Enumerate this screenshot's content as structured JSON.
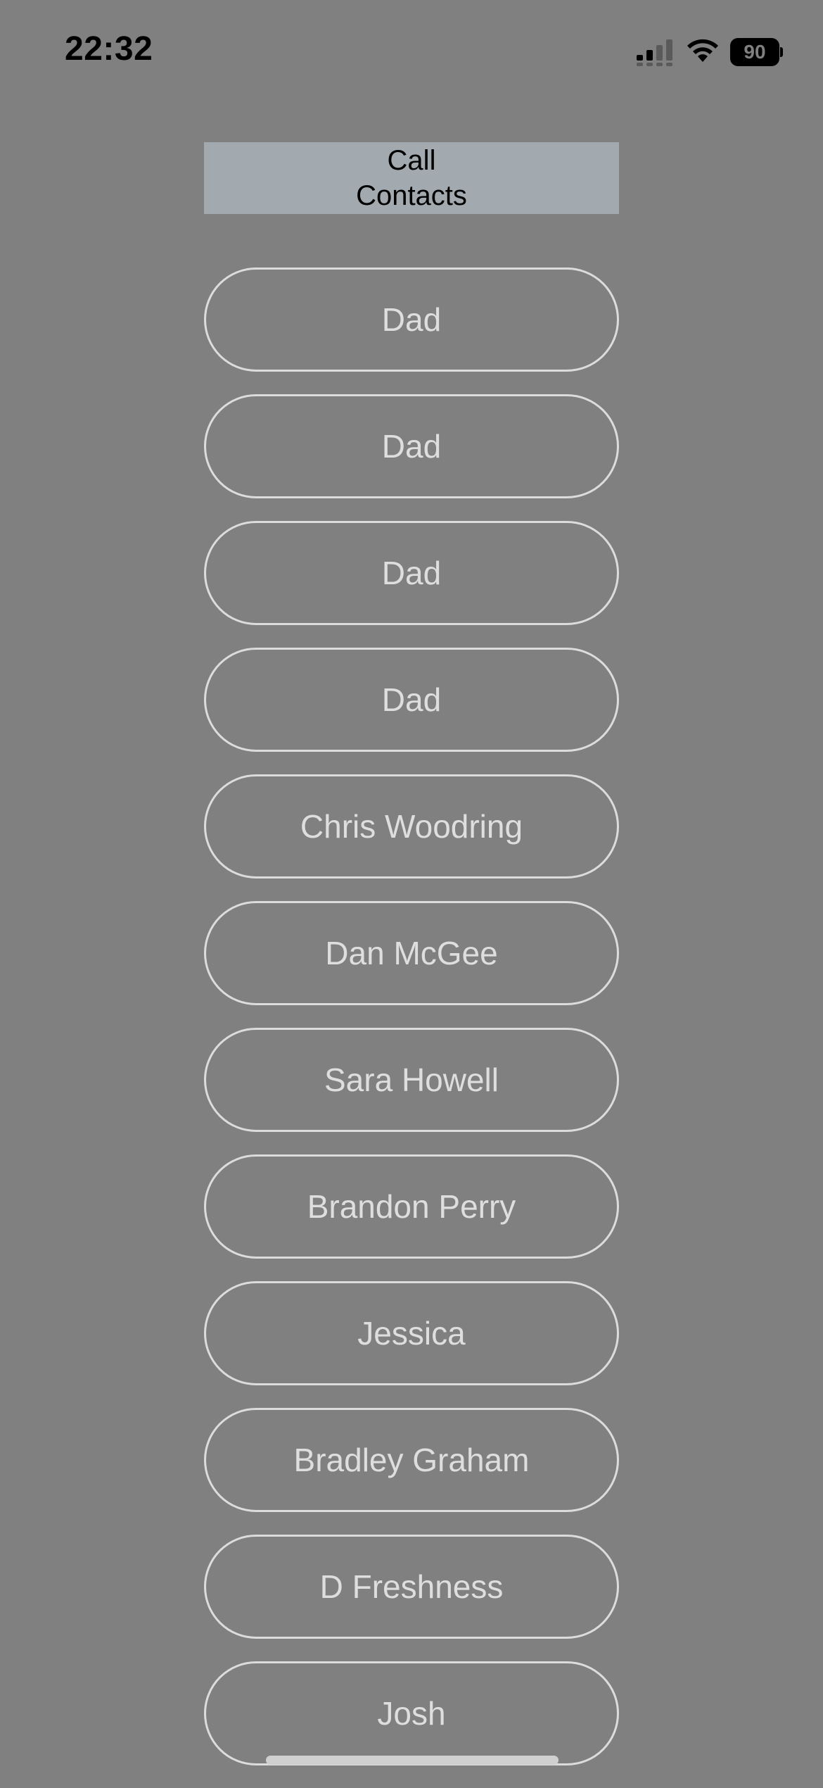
{
  "status_bar": {
    "time": "22:32",
    "battery_level": "90",
    "icons": [
      "signal-icon",
      "wifi-icon",
      "battery-icon"
    ]
  },
  "header": {
    "line1": "Call",
    "line2": "Contacts"
  },
  "contacts": [
    "Dad",
    "Dad",
    "Dad",
    "Dad",
    "Chris Woodring",
    "Dan McGee",
    "Sara Howell",
    "Brandon Perry",
    "Jessica",
    "Bradley Graham",
    "D Freshness",
    "Josh"
  ],
  "colors": {
    "background": "#808080",
    "header_background": "#a2aab0",
    "button_border": "#dcdcdc",
    "button_text": "#dedede"
  }
}
